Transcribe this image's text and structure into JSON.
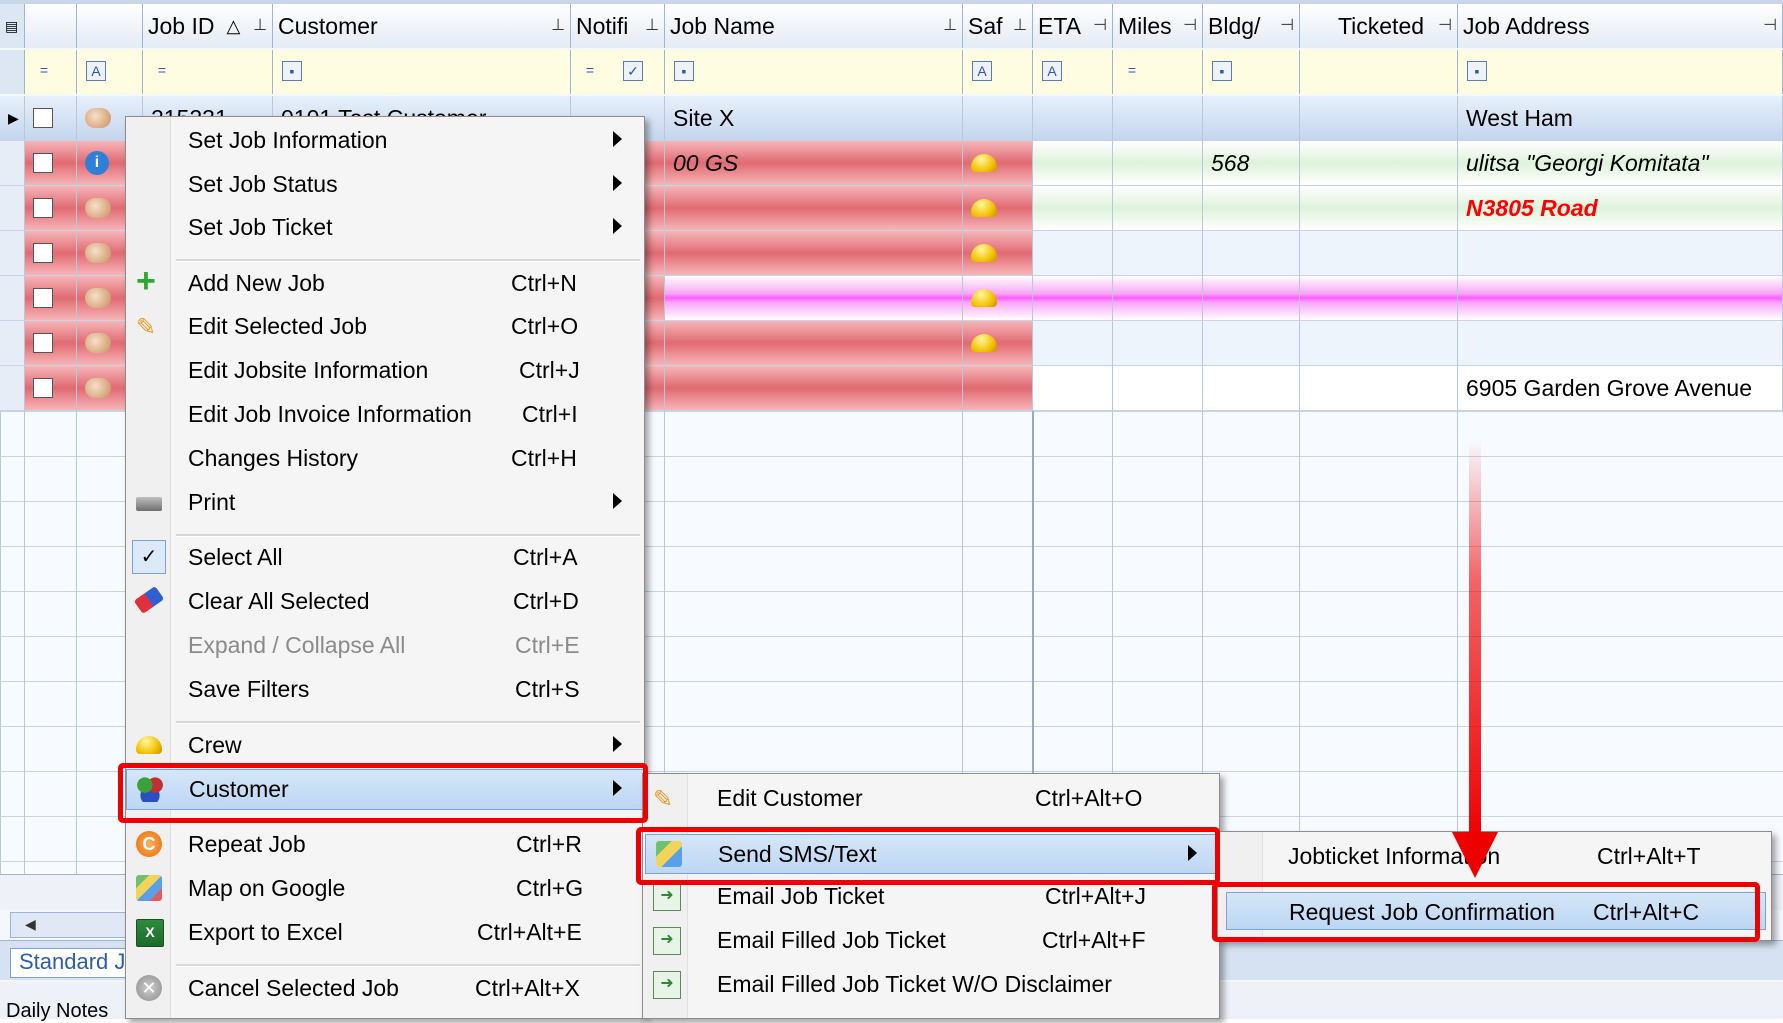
{
  "grid": {
    "headers": {
      "job_id": "Job ID",
      "customer": "Customer",
      "notifi": "Notifi",
      "job_name": "Job Name",
      "saf": "Saf",
      "eta": "ETA",
      "miles": "Miles",
      "bldg": "Bldg/",
      "ticketed": "Ticketed",
      "job_address": "Job Address"
    },
    "rows": [
      {
        "job_id": "215231",
        "customer": "0101 Test Customer",
        "job_name": "Site X",
        "bldg": "",
        "address": "West Ham"
      },
      {
        "job_id": "",
        "customer": "",
        "job_name": "00 GS",
        "bldg": "568",
        "address": "ulitsa \"Georgi Komitata\""
      },
      {
        "job_id": "",
        "customer": "",
        "job_name": "",
        "bldg": "",
        "address": "N3805 Road"
      },
      {
        "job_id": "",
        "customer": "",
        "job_name": "",
        "bldg": "",
        "address": ""
      },
      {
        "job_id": "",
        "customer": "",
        "job_name": "",
        "bldg": "",
        "address": ""
      },
      {
        "job_id": "",
        "customer": "",
        "job_name": "",
        "bldg": "",
        "address": ""
      },
      {
        "job_id": "",
        "customer": "",
        "job_name": "",
        "bldg": "",
        "address": "6905 Garden Grove Avenue"
      }
    ],
    "tab_label": "Standard J",
    "daily_notes_label": "Daily Notes"
  },
  "context_menu": {
    "items": [
      {
        "label": "Set Job Information",
        "shortcut": "",
        "submenu": true
      },
      {
        "label": "Set Job Status",
        "shortcut": "",
        "submenu": true
      },
      {
        "label": "Set Job Ticket",
        "shortcut": "",
        "submenu": true
      },
      {
        "label": "Add New Job",
        "shortcut": "Ctrl+N",
        "icon": "green-plus-icon"
      },
      {
        "label": "Edit Selected Job",
        "shortcut": "Ctrl+O",
        "icon": "pencil-icon"
      },
      {
        "label": "Edit Jobsite Information",
        "shortcut": "Ctrl+J"
      },
      {
        "label": "Edit Job Invoice Information",
        "shortcut": "Ctrl+I"
      },
      {
        "label": "Changes History",
        "shortcut": "Ctrl+H"
      },
      {
        "label": "Print",
        "shortcut": "",
        "submenu": true,
        "icon": "printer-icon"
      },
      {
        "label": "Select All",
        "shortcut": "Ctrl+A",
        "icon": "checkmark-icon"
      },
      {
        "label": "Clear All Selected",
        "shortcut": "Ctrl+D",
        "icon": "eraser-icon"
      },
      {
        "label": "Expand / Collapse All",
        "shortcut": "Ctrl+E",
        "disabled": true
      },
      {
        "label": "Save Filters",
        "shortcut": "Ctrl+S"
      },
      {
        "label": "Crew",
        "shortcut": "",
        "submenu": true,
        "icon": "hardhat-icon"
      },
      {
        "label": "Customer",
        "shortcut": "",
        "submenu": true,
        "icon": "people-icon"
      },
      {
        "label": "Repeat Job",
        "shortcut": "Ctrl+R",
        "icon": "repeat-icon"
      },
      {
        "label": "Map on Google",
        "shortcut": "Ctrl+G",
        "icon": "map-icon"
      },
      {
        "label": "Export to Excel",
        "shortcut": "Ctrl+Alt+E",
        "icon": "excel-icon"
      },
      {
        "label": "Cancel Selected Job",
        "shortcut": "Ctrl+Alt+X",
        "icon": "cancel-icon"
      }
    ]
  },
  "customer_submenu": {
    "items": [
      {
        "label": "Edit Customer",
        "shortcut": "Ctrl+Alt+O"
      },
      {
        "label": "Send SMS/Text",
        "shortcut": "",
        "submenu": true
      },
      {
        "label": "Email Job Ticket",
        "shortcut": "Ctrl+Alt+J"
      },
      {
        "label": "Email Filled Job Ticket",
        "shortcut": "Ctrl+Alt+F"
      },
      {
        "label": "Email Filled Job Ticket W/O Disclaimer",
        "shortcut": ""
      }
    ]
  },
  "sms_submenu": {
    "items": [
      {
        "label": "Jobticket Information",
        "shortcut": "Ctrl+Alt+T"
      },
      {
        "label": "Request Job Confirmation",
        "shortcut": "Ctrl+Alt+C"
      }
    ]
  },
  "colors": {
    "highlight_red": "#ee0000",
    "row_red": "#e06a72",
    "filter_yellow": "#fffde1",
    "address_red_text": "#ff0000"
  }
}
